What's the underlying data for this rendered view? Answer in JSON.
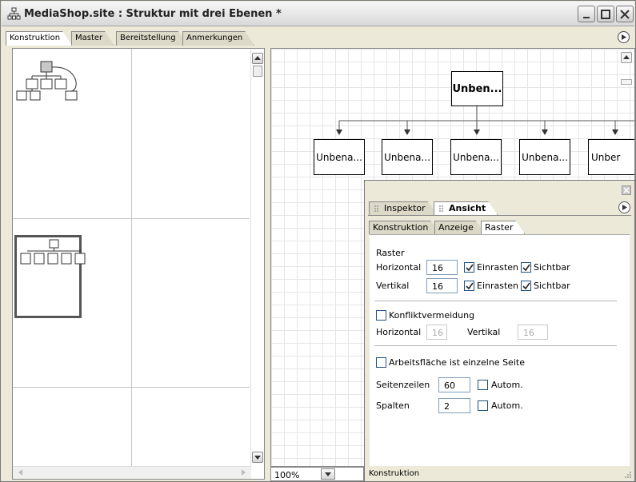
{
  "window": {
    "title": "MediaShop.site : Struktur mit drei Ebenen *"
  },
  "tabs": [
    "Konstruktion",
    "Master",
    "Bereitstellung",
    "Anmerkungen"
  ],
  "canvas": {
    "root_label": "Unben...",
    "child_labels": [
      "Unbena...",
      "Unbena...",
      "Unbena...",
      "Unbena...",
      "Unber"
    ]
  },
  "zoom": {
    "value": "100%"
  },
  "panel": {
    "tabs": [
      "Inspektor",
      "Ansicht"
    ],
    "subtabs": [
      "Konstruktion",
      "Anzeige",
      "Raster"
    ],
    "raster": {
      "heading": "Raster",
      "horizontal_label": "Horizontal",
      "horizontal_value": "16",
      "vertical_label": "Vertikal",
      "vertical_value": "16",
      "snap_label": "Einrasten",
      "visible_label": "Sichtbar"
    },
    "conflict": {
      "label": "Konfliktvermeidung",
      "horizontal_label": "Horizontal",
      "horizontal_value": "16",
      "vertical_label": "Vertikal",
      "vertical_value": "16"
    },
    "page": {
      "single_page_label": "Arbeitsfläche ist einzelne Seite",
      "rows_label": "Seitenzeilen",
      "rows_value": "60",
      "cols_label": "Spalten",
      "cols_value": "2",
      "auto_label": "Autom."
    },
    "status": "Konstruktion"
  }
}
